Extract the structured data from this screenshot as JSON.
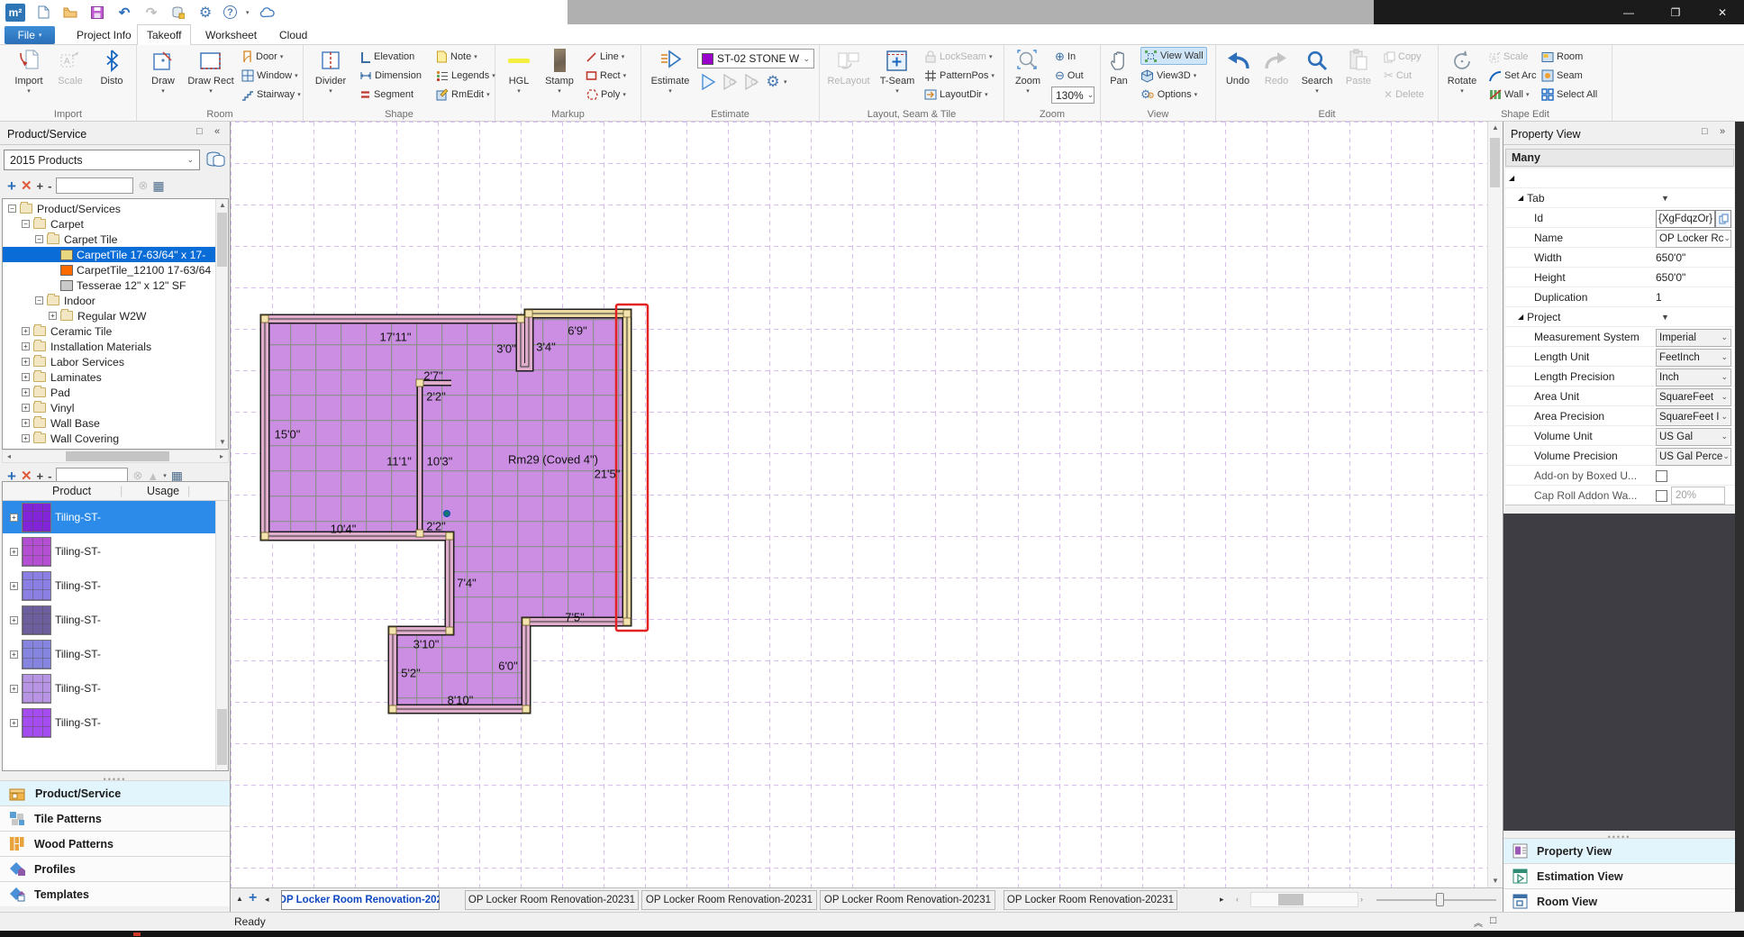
{
  "titlebar": {
    "logo": "m²",
    "minimize": "—",
    "maximize": "❐",
    "close": "✕"
  },
  "menu": {
    "file": "File",
    "tabs": {
      "project_info": "Project Info",
      "takeoff": "Takeoff",
      "worksheet": "Worksheet",
      "cloud": "Cloud"
    }
  },
  "ribbon": {
    "group_titles": {
      "import": "Import",
      "room": "Room",
      "shape": "Shape",
      "markup": "Markup",
      "estimate": "Estimate",
      "layout": "Layout, Seam & Tile",
      "zoom": "Zoom",
      "view": "View",
      "edit": "Edit",
      "shape_edit": "Shape Edit"
    },
    "labels": {
      "import": "Import",
      "scale": "Scale",
      "disto": "Disto",
      "draw": "Draw",
      "draw_rect": "Draw Rect",
      "door": "Door",
      "window": "Window",
      "stairway": "Stairway",
      "divider": "Divider",
      "elevation": "Elevation",
      "dimension": "Dimension",
      "segment": "Segment",
      "note": "Note",
      "legends": "Legends",
      "rmedit": "RmEdit",
      "hgl": "HGL",
      "stamp": "Stamp",
      "line": "Line",
      "rect": "Rect",
      "poly": "Poly",
      "estimate": "Estimate",
      "relayout": "ReLayout",
      "tseam": "T-Seam",
      "lockseam": "LockSeam",
      "patternpos": "PatternPos",
      "layoutdir": "LayoutDir",
      "zoom": "Zoom",
      "zoom_in": "In",
      "zoom_out": "Out",
      "pan": "Pan",
      "view_wall": "View Wall",
      "view3d": "View3D",
      "options": "Options",
      "undo": "Undo",
      "redo": "Redo",
      "search": "Search",
      "paste": "Paste",
      "copy": "Copy",
      "cut": "Cut",
      "delete": "Delete",
      "rotate": "Rotate",
      "scale2": "Scale",
      "set_arc": "Set Arc",
      "wall": "Wall",
      "room": "Room",
      "seam": "Seam",
      "select_all": "Select All"
    },
    "estimate": {
      "product": "ST-02 STONE W",
      "swatch_color": "#9900cc"
    },
    "zoom_level": "130%"
  },
  "left_panel": {
    "title": "Product/Service",
    "catalog": "2015 Products",
    "tree": {
      "items": [
        {
          "label": "Product/Services"
        },
        {
          "label": "Carpet"
        },
        {
          "label": "Carpet Tile"
        },
        {
          "label": "CarpetTile 17-63/64\" x 17-",
          "swatch": "#e9d77f"
        },
        {
          "label": "CarpetTile_12100 17-63/64",
          "swatch": "#fd6a00"
        },
        {
          "label": "Tesserae 12\" x 12\" SF",
          "swatch": "#c9c9c9"
        },
        {
          "label": "Indoor"
        },
        {
          "label": "Regular W2W"
        },
        {
          "label": "Ceramic Tile"
        },
        {
          "label": "Installation Materials"
        },
        {
          "label": "Labor Services"
        },
        {
          "label": "Laminates"
        },
        {
          "label": "Pad"
        },
        {
          "label": "Vinyl"
        },
        {
          "label": "Wall Base"
        },
        {
          "label": "Wall Covering"
        }
      ]
    },
    "table": {
      "col_product": "Product",
      "col_usage": "Usage",
      "rows": [
        {
          "label": "Tiling-ST-",
          "color": "#8224d8"
        },
        {
          "label": "Tiling-ST-",
          "color": "#b44fd4"
        },
        {
          "label": "Tiling-ST-",
          "color": "#8b7fe4"
        },
        {
          "label": "Tiling-ST-",
          "color": "#6d5f9e"
        },
        {
          "label": "Tiling-ST-",
          "color": "#8585e0"
        },
        {
          "label": "Tiling-ST-",
          "color": "#b795e4"
        },
        {
          "label": "Tiling-ST-",
          "color": "#a44cf0"
        }
      ]
    },
    "nav": {
      "product_service": "Product/Service",
      "tile_patterns": "Tile Patterns",
      "wood_patterns": "Wood Patterns",
      "profiles": "Profiles",
      "templates": "Templates"
    }
  },
  "canvas": {
    "dims": [
      {
        "text": "17'11\""
      },
      {
        "text": "6'9\""
      },
      {
        "text": "3'0\""
      },
      {
        "text": "3'4\""
      },
      {
        "text": "2'7\""
      },
      {
        "text": "2'2\""
      },
      {
        "text": "15'0\""
      },
      {
        "text": "11'1\""
      },
      {
        "text": "10'3\""
      },
      {
        "text": "Rm29 (Coved 4\")"
      },
      {
        "text": "21'5\""
      },
      {
        "text": "10'4\""
      },
      {
        "text": "2'2\""
      },
      {
        "text": "7'4\""
      },
      {
        "text": "7'5\""
      },
      {
        "text": "3'10\""
      },
      {
        "text": "5'2\""
      },
      {
        "text": "6'0\""
      },
      {
        "text": "8'10\""
      }
    ],
    "colors": {
      "room_fill": "#cb8ee2",
      "tile_line": "#8f8f8f",
      "wall_pink": "#dfaccb",
      "wall_tan": "#ecd9a2",
      "grid": "#d9bef2",
      "selection": "#e32222"
    },
    "tabs": [
      {
        "label": "OP Locker Room Renovation-202"
      },
      {
        "label": "OP Locker Room Renovation-20231"
      },
      {
        "label": "OP Locker Room Renovation-20231"
      },
      {
        "label": "OP Locker Room Renovation-20231"
      },
      {
        "label": "OP Locker Room Renovation-20231"
      }
    ]
  },
  "right_panel": {
    "title": "Property View",
    "group": "Many",
    "tab_section": "Tab",
    "project_section": "Project",
    "rows": {
      "id_label": "Id",
      "id_value": "{XgFdqzOr}",
      "name_label": "Name",
      "name_value": "OP Locker Rc",
      "width_label": "Width",
      "width_value": "650'0\"",
      "height_label": "Height",
      "height_value": "650'0\"",
      "dup_label": "Duplication",
      "dup_value": "1",
      "ms_label": "Measurement System",
      "ms_value": "Imperial",
      "lu_label": "Length Unit",
      "lu_value": "FeetInch",
      "lp_label": "Length Precision",
      "lp_value": "Inch",
      "au_label": "Area Unit",
      "au_value": "SquareFeet",
      "ap_label": "Area Precision",
      "ap_value": "SquareFeet I",
      "vu_label": "Volume Unit",
      "vu_value": "US Gal",
      "vp_label": "Volume Precision",
      "vp_value": "US Gal Perce",
      "addon_label": "Add-on by Boxed U...",
      "cap_label": "Cap Roll Addon Wa...",
      "cap_value": "20%"
    },
    "views": {
      "property": "Property View",
      "estimation": "Estimation View",
      "room": "Room View"
    }
  },
  "status": {
    "ready": "Ready"
  }
}
